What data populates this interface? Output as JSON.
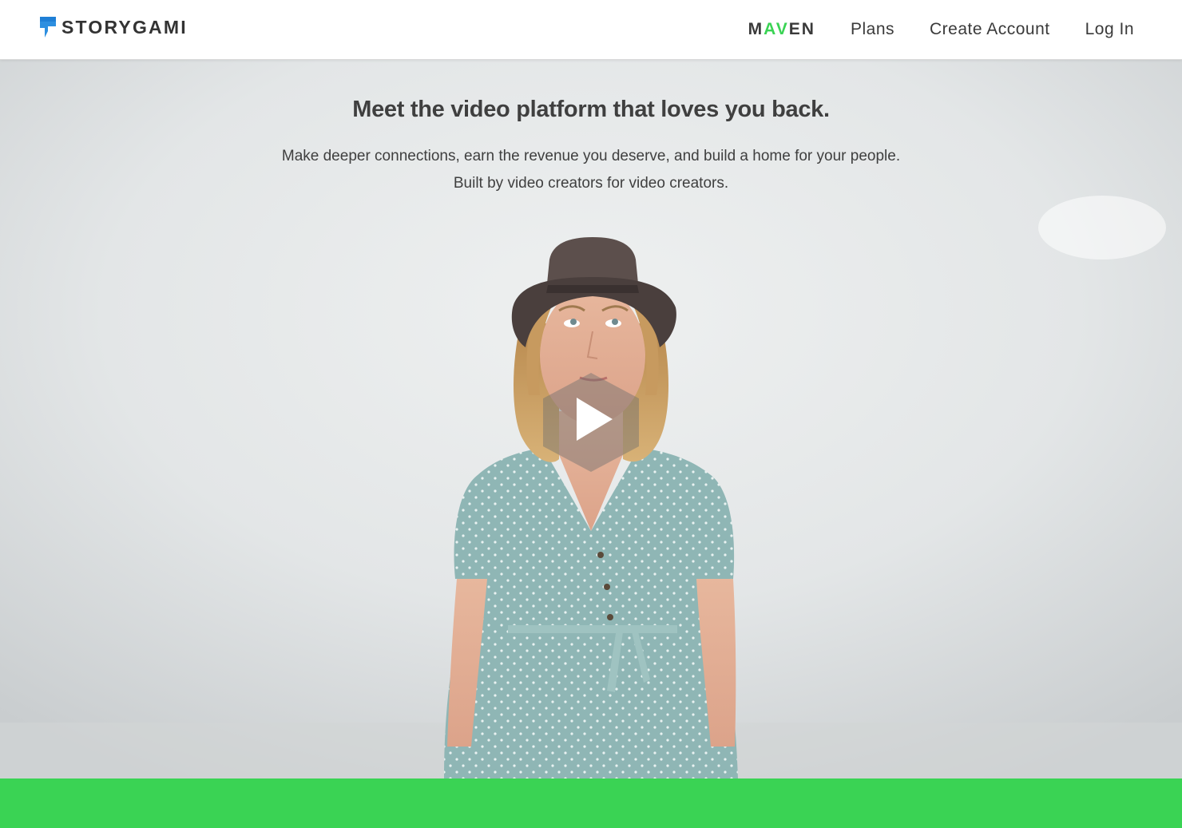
{
  "header": {
    "logo_text": "STORYGAMI",
    "nav": {
      "maven": {
        "part1": "M",
        "accent": "AV",
        "part2": "EN"
      },
      "plans": "Plans",
      "create_account": "Create Account",
      "log_in": "Log In"
    }
  },
  "hero": {
    "title": "Meet the video platform that loves you back.",
    "subtitle_line1": "Make deeper connections, earn the revenue you deserve, and build a home for your people.",
    "subtitle_line2": "Built by video creators for video creators."
  },
  "colors": {
    "brand_green": "#3ad354",
    "logo_blue": "#2d8fe0",
    "text_dark": "#3d3d3d"
  },
  "icons": {
    "logo": "storygami-flag-icon",
    "play": "play-icon"
  }
}
